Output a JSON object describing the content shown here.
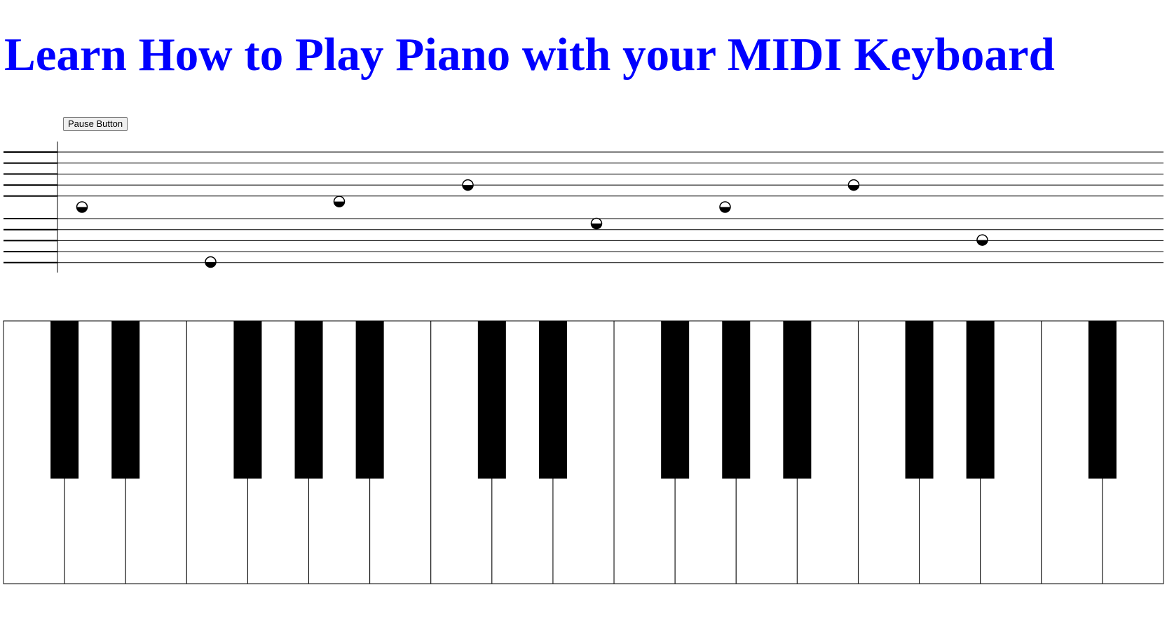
{
  "page": {
    "title": "Learn How to Play Piano with your MIDI Keyboard",
    "pause_label": "Pause Button"
  },
  "colors": {
    "title": "#0000ff",
    "note_fill": "#000000",
    "black_key": "#000000",
    "white_key": "#ffffff"
  },
  "staff": {
    "treble_lines": 5,
    "bass_lines": 5,
    "notes": [
      {
        "pos": 2,
        "icon": "half-note-icon"
      },
      {
        "pos": 7,
        "icon": "half-note-icon"
      },
      {
        "pos": 1.5,
        "icon": "half-note-icon"
      },
      {
        "pos": 0,
        "icon": "half-note-icon"
      },
      {
        "pos": 3.5,
        "icon": "half-note-icon"
      },
      {
        "pos": 2,
        "icon": "half-note-icon"
      },
      {
        "pos": 0,
        "icon": "half-note-icon"
      },
      {
        "pos": 5,
        "icon": "half-note-icon"
      }
    ]
  },
  "keyboard": {
    "white_keys": 19,
    "black_keys": [
      0,
      1,
      3,
      4,
      5,
      7,
      8,
      10,
      11,
      12,
      14,
      15,
      17
    ]
  }
}
